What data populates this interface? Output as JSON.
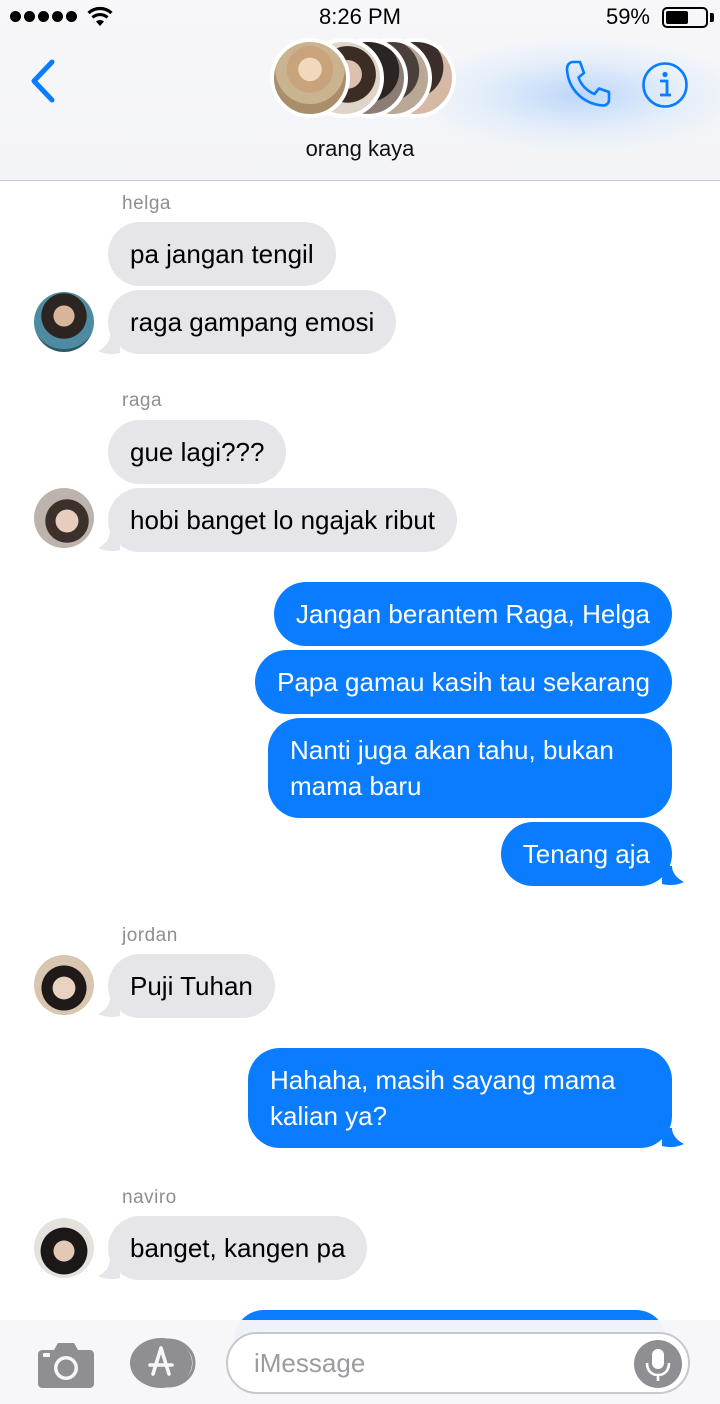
{
  "status_bar": {
    "time": "8:26 PM",
    "battery_percent": "59%",
    "battery_level": 0.59,
    "signal_bars": 5
  },
  "header": {
    "group_name": "orang kaya",
    "back_icon": "chevron-left-icon",
    "call_icon": "phone-icon",
    "info_icon": "info-icon"
  },
  "messages": [
    {
      "sender": "helga",
      "direction": "in",
      "text": "pa jangan tengil"
    },
    {
      "direction": "in",
      "text": "raga gampang emosi"
    },
    {
      "sender": "raga",
      "direction": "in",
      "text": "gue lagi???"
    },
    {
      "direction": "in",
      "text": "hobi banget lo ngajak ribut"
    },
    {
      "direction": "out",
      "text": "Jangan berantem Raga, Helga"
    },
    {
      "direction": "out",
      "text": "Papa gamau kasih tau sekarang"
    },
    {
      "direction": "out",
      "text": "Nanti juga akan tahu, bukan mama baru"
    },
    {
      "direction": "out",
      "text": "Tenang aja"
    },
    {
      "sender": "jordan",
      "direction": "in",
      "text": "Puji Tuhan"
    },
    {
      "direction": "out",
      "text": "Hahaha, masih sayang mama kalian ya?"
    },
    {
      "sender": "naviro",
      "direction": "in",
      "text": "banget, kangen pa"
    }
  ],
  "input_bar": {
    "placeholder": "iMessage",
    "value": "",
    "camera_icon": "camera-icon",
    "apps_icon": "app-store-icon",
    "mic_icon": "microphone-icon"
  },
  "colors": {
    "accent": "#0a7cff",
    "incoming_bubble": "#e5e5ea",
    "sender_label": "#8e8e93"
  }
}
